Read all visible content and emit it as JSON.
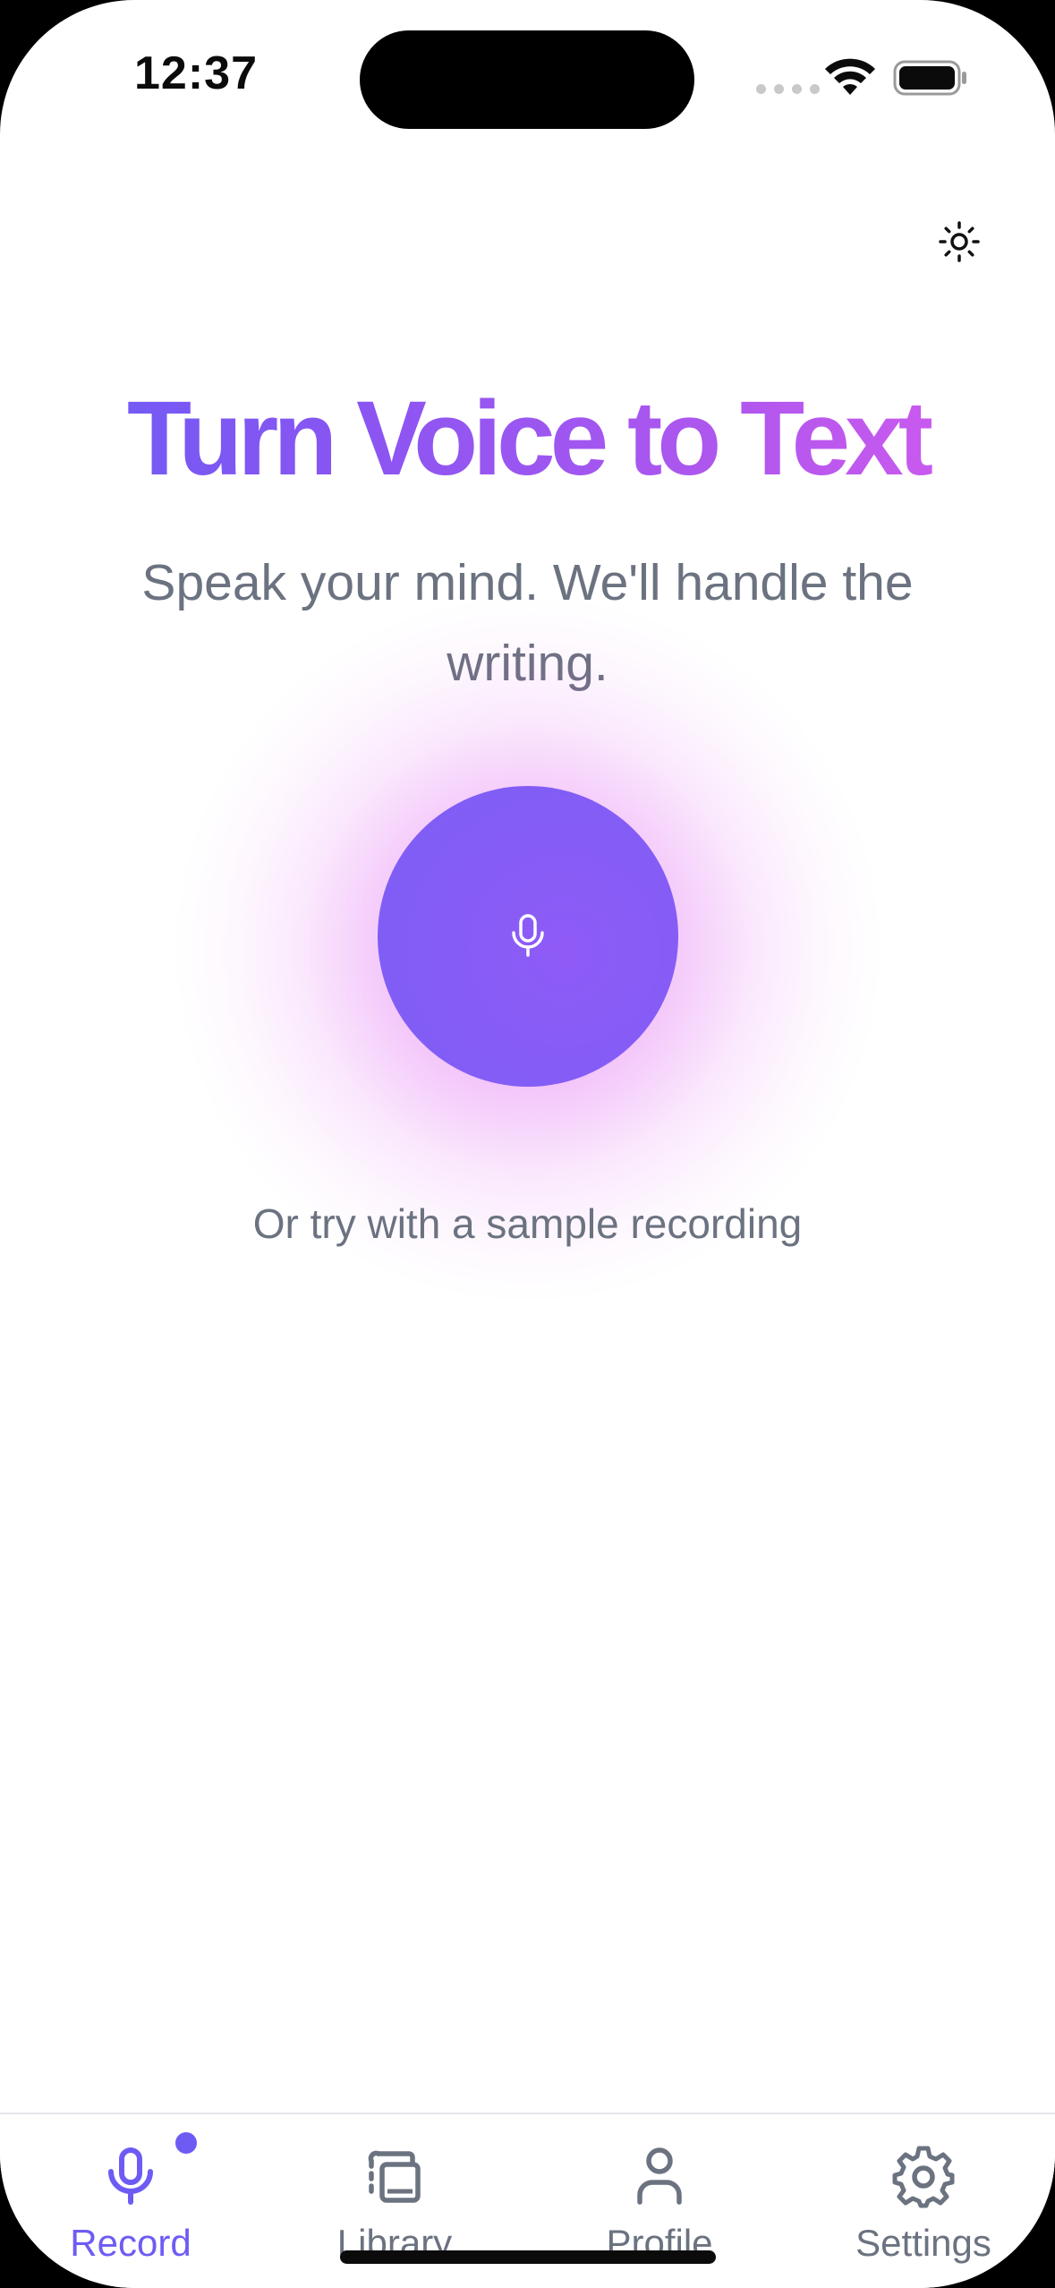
{
  "status_bar": {
    "time": "12:37"
  },
  "theme_toggle": {
    "icon": "sun-icon"
  },
  "hero": {
    "title": "Turn Voice to Text",
    "subtitle": "Speak your mind. We'll handle the writing."
  },
  "record_button": {
    "icon": "microphone-icon"
  },
  "sample_link": "Or try with a sample recording",
  "tabs": [
    {
      "label": "Record",
      "icon": "microphone-icon",
      "active": true
    },
    {
      "label": "Library",
      "icon": "library-icon",
      "active": false
    },
    {
      "label": "Profile",
      "icon": "person-icon",
      "active": false
    },
    {
      "label": "Settings",
      "icon": "gear-icon",
      "active": false
    }
  ],
  "colors": {
    "accent": "#6d5cf3",
    "gradient_start": "#6a5cf5",
    "gradient_end": "#d85bef",
    "muted_text": "#6b7280"
  }
}
